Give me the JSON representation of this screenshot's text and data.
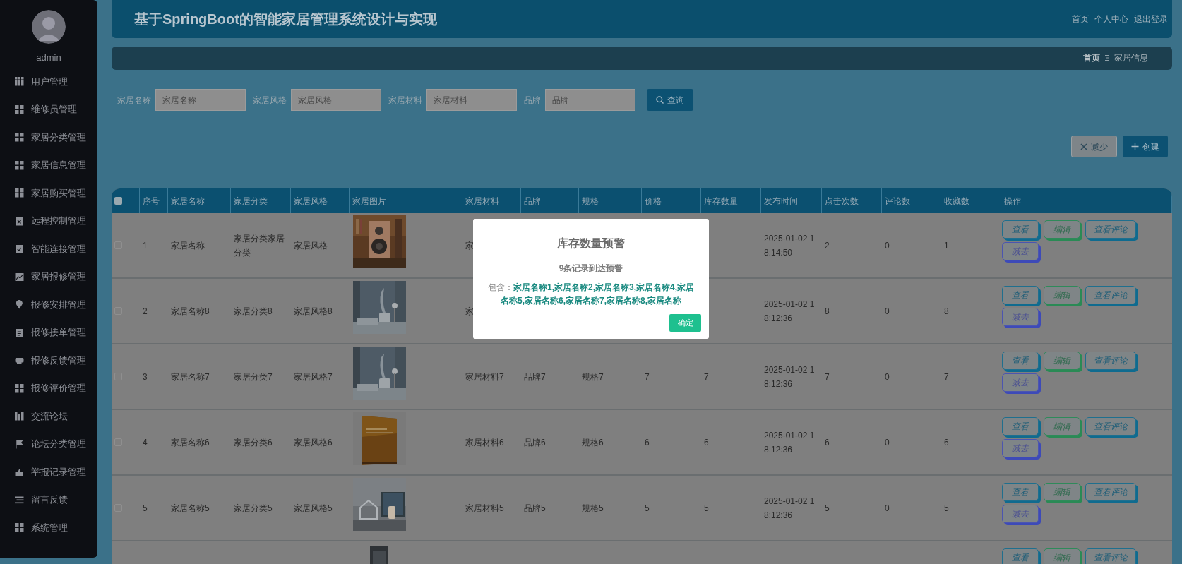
{
  "sidebar": {
    "user": "admin",
    "items": [
      {
        "label": "用户管理"
      },
      {
        "label": "维修员管理"
      },
      {
        "label": "家居分类管理"
      },
      {
        "label": "家居信息管理"
      },
      {
        "label": "家居购买管理"
      },
      {
        "label": "远程控制管理"
      },
      {
        "label": "智能连接管理"
      },
      {
        "label": "家居报修管理"
      },
      {
        "label": "报修安排管理"
      },
      {
        "label": "报修接单管理"
      },
      {
        "label": "报修反馈管理"
      },
      {
        "label": "报修评价管理"
      },
      {
        "label": "交流论坛"
      },
      {
        "label": "论坛分类管理"
      },
      {
        "label": "举报记录管理"
      },
      {
        "label": "留言反馈"
      },
      {
        "label": "系统管理"
      }
    ]
  },
  "header": {
    "title": "基于SpringBoot的智能家居管理系统设计与实现",
    "links": [
      "首页",
      "个人中心",
      "退出登录"
    ]
  },
  "breadcrumb": [
    "首页",
    "家居信息"
  ],
  "search": {
    "fields": [
      {
        "label": "家居名称",
        "placeholder": "家居名称"
      },
      {
        "label": "家居风格",
        "placeholder": "家居风格"
      },
      {
        "label": "家居材料",
        "placeholder": "家居材料"
      },
      {
        "label": "品牌",
        "placeholder": "品牌"
      }
    ],
    "button": "查询"
  },
  "toolbar": [
    "减少",
    "创建"
  ],
  "table": {
    "header_checked": false,
    "columns": [
      "序号",
      "家居名称",
      "家居分类",
      "家居风格",
      "家居图片",
      "家居材料",
      "品牌",
      "规格",
      "价格",
      "库存数量",
      "发布时间",
      "点击次数",
      "评论数",
      "收藏数",
      "操作"
    ],
    "rows": [
      {
        "checked": false,
        "no": "1",
        "name": "家居名称",
        "category": "家居分类家居分类",
        "style": "家居风格",
        "image": {
          "kind": "picture"
        },
        "material": "家",
        "published": "2025-01-02 18:14:50",
        "clicks": "2",
        "comments": "0",
        "favorites": "1",
        "actions": [
          "查看",
          "编辑",
          "查看评论",
          "减去"
        ]
      },
      {
        "checked": false,
        "no": "2",
        "name": "家居名称8",
        "category": "家居分类8",
        "style": "家居风格8",
        "image": {
          "kind": "picture"
        },
        "material": "家",
        "published": "2025-01-02 18:12:36",
        "clicks": "8",
        "comments": "0",
        "favorites": "8",
        "actions": [
          "查看",
          "编辑",
          "查看评论",
          "减去"
        ]
      },
      {
        "checked": false,
        "no": "3",
        "name": "家居名称7",
        "category": "家居分类7",
        "style": "家居风格7",
        "image": {
          "kind": "picture"
        },
        "material": "家居材料7",
        "brand": "品牌7",
        "spec": "规格7",
        "price": "7",
        "stock": "7",
        "published": "2025-01-02 18:12:36",
        "clicks": "7",
        "comments": "0",
        "favorites": "7",
        "actions": [
          "查看",
          "编辑",
          "查看评论",
          "减去"
        ]
      },
      {
        "checked": false,
        "no": "4",
        "name": "家居名称6",
        "category": "家居分类6",
        "style": "家居风格6",
        "image": {
          "kind": "picture"
        },
        "material": "家居材料6",
        "brand": "品牌6",
        "spec": "规格6",
        "price": "6",
        "stock": "6",
        "published": "2025-01-02 18:12:36",
        "clicks": "6",
        "comments": "0",
        "favorites": "6",
        "actions": [
          "查看",
          "编辑",
          "查看评论",
          "减去"
        ]
      },
      {
        "checked": false,
        "no": "5",
        "name": "家居名称5",
        "category": "家居分类5",
        "style": "家居风格5",
        "image": {
          "kind": "picture"
        },
        "material": "家居材料5",
        "brand": "品牌5",
        "spec": "规格5",
        "price": "5",
        "stock": "5",
        "published": "2025-01-02 18:12:36",
        "clicks": "5",
        "comments": "0",
        "favorites": "5",
        "actions": [
          "查看",
          "编辑",
          "查看评论",
          "减去"
        ]
      },
      {
        "image": {
          "kind": "picture"
        },
        "actions": [
          "查看",
          "编辑",
          "查看评论"
        ]
      }
    ]
  },
  "dialog": {
    "title": "库存数量预警",
    "subtitle": "9条记录到达预警",
    "contains_label": "包含：",
    "items": "家居名称1,家居名称2,家居名称3,家居名称4,家居名称5,家居名称6,家居名称7,家居名称8,家居名称",
    "button": "确定"
  }
}
